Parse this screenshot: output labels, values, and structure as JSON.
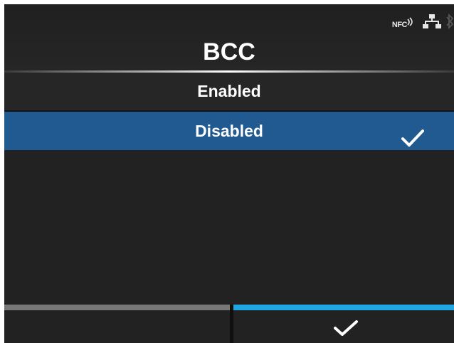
{
  "status_bar": {
    "nfc_label": "NFC",
    "icons": [
      "nfc-icon",
      "wired-lan-icon",
      "bluetooth-icon"
    ]
  },
  "header": {
    "title": "BCC"
  },
  "options": [
    {
      "label": "Enabled",
      "selected": false
    },
    {
      "label": "Disabled",
      "selected": true,
      "icon": "checkmark-icon"
    }
  ],
  "softkeys": {
    "left": {
      "label": "",
      "accent": "#777777"
    },
    "right": {
      "icon": "checkmark-icon",
      "accent": "#1fa7e2"
    }
  },
  "colors": {
    "background": "#222222",
    "selection": "#215a91",
    "accent": "#1fa7e2"
  }
}
